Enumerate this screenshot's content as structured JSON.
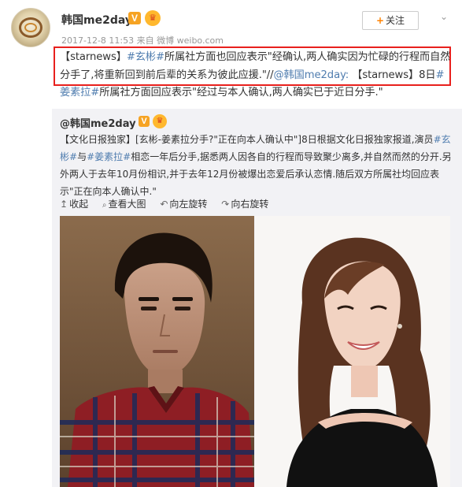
{
  "header": {
    "username": "韩国me2day",
    "verified_badge": "V",
    "timestamp": "2017-12-8 11:53",
    "source": "来自 微博 weibo.com",
    "follow_label": "关注",
    "follow_icon": "plus-icon",
    "menu_icon": "chevron-down-icon"
  },
  "post": {
    "p1": "【starnews】",
    "tag1": "#玄彬#",
    "p2": "所属社方面也回应表示\"经确认,两人确实因为忙碌的行程而自然分手了,将重新回到前后辈的关系为彼此应援.\"//",
    "mention": "@韩国me2day:",
    "p3": " 【starnews】8日",
    "tag2": "#姜素拉#",
    "p4": "所属社方面回应表示\"经过与本人确认,两人确实已于近日分手.\""
  },
  "repost": {
    "username": "@韩国me2day",
    "verified_badge": "V",
    "p1": "【文化日报独家】[玄彬-姜素拉分手?\"正在向本人确认中\"]8日根据文化日报独家报道,演员",
    "tag1": "#玄彬#",
    "p2": "与",
    "tag2": "#姜素拉#",
    "p3": "相恋一年后分手,据悉两人因各自的行程而导致聚少离多,并自然而然的分开.另外两人于去年10月份相识,并于去年12月份被爆出恋爱后承认恋情.随后双方所属社均回应表示\"正在向本人确认中.\""
  },
  "actions": [
    {
      "label": "收起",
      "icon": "collapse-icon",
      "glyph": "↥"
    },
    {
      "label": "查看大图",
      "icon": "zoom-icon",
      "glyph": "🔍"
    },
    {
      "label": "向左旋转",
      "icon": "rotate-left-icon",
      "glyph": "↶"
    },
    {
      "label": "向右旋转",
      "icon": "rotate-right-icon",
      "glyph": "↷"
    }
  ],
  "colors": {
    "highlight": "#eb7350",
    "link": "#507daf",
    "box": "#e8201d",
    "repost_bg": "#f2f2f5"
  }
}
